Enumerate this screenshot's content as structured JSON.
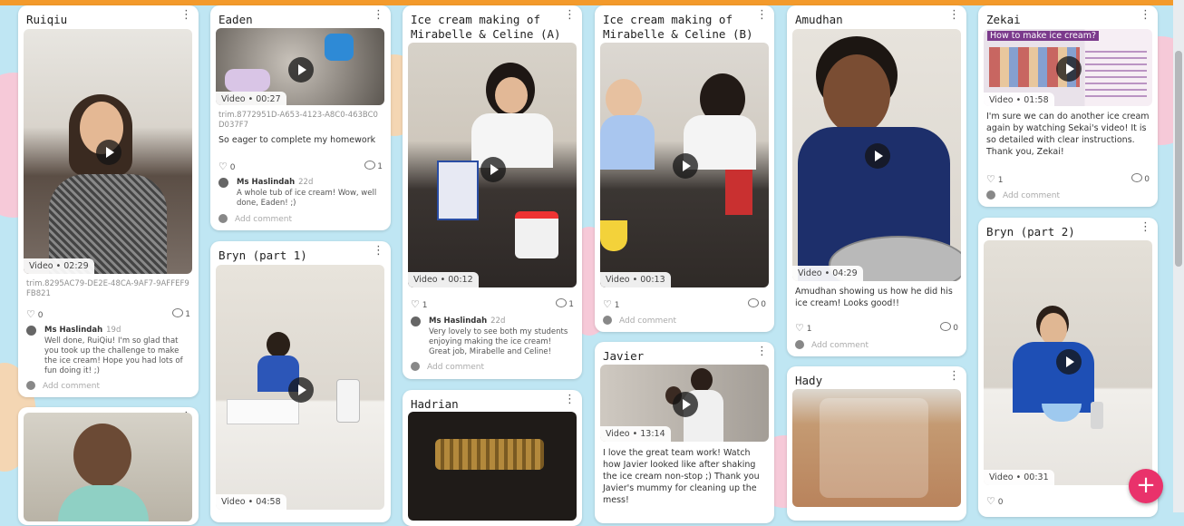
{
  "posts": {
    "ruiqiu": {
      "title": "Ruiqiu",
      "badge": "Video • 02:29",
      "filename": "trim.8295AC79-DE2E-48CA-9AF7-9AFFEF9FB821",
      "likes": "0",
      "comments": "1",
      "comment": {
        "author": "Ms Haslindah",
        "date": "19d",
        "text": "Well done, RuiQiu! I'm so glad that you took up the challenge to make the ice cream! Hope you had lots of fun doing it! ;)"
      },
      "add_comment": "Add comment"
    },
    "eaden": {
      "title": "Eaden",
      "badge": "Video • 00:27",
      "filename": "trim.8772951D-A653-4123-A8C0-463BC0D037F7",
      "text": "So eager to complete my homework",
      "likes": "0",
      "comments": "1",
      "comment": {
        "author": "Ms Haslindah",
        "date": "22d",
        "text": "A whole tub of ice cream! Wow, well done, Eaden! ;)"
      },
      "add_comment": "Add comment"
    },
    "bryn1": {
      "title": "Bryn (part 1)",
      "badge": "Video • 04:58"
    },
    "icecream_a": {
      "title": "Ice cream making of Mirabelle & Celine (A)",
      "badge": "Video • 00:12",
      "likes": "1",
      "comments": "1",
      "comment": {
        "author": "Ms Haslindah",
        "date": "22d",
        "text": "Very lovely to see both my students enjoying making the ice cream! Great job, Mirabelle and Celine!"
      },
      "add_comment": "Add comment"
    },
    "hadrian": {
      "title": "Hadrian"
    },
    "icecream_b": {
      "title": "Ice cream making of Mirabelle & Celine (B)",
      "badge": "Video • 00:13",
      "likes": "1",
      "comments": "0",
      "add_comment": "Add comment"
    },
    "javier": {
      "title": "Javier",
      "badge": "Video • 13:14",
      "text": "I love the great team work! Watch how Javier looked like after shaking the ice cream non-stop ;) Thank you Javier's mummy for cleaning up the mess!"
    },
    "amudhan": {
      "title": "Amudhan",
      "badge": "Video • 04:29",
      "text": "Amudhan showing us how he did his ice cream! Looks good!!",
      "likes": "1",
      "comments": "0",
      "add_comment": "Add comment"
    },
    "hady": {
      "title": "Hady"
    },
    "zekai": {
      "title": "Zekai",
      "badge": "Video • 01:58",
      "thumb_text": "How to make ice cream?",
      "text": "I'm sure we can do another ice cream again by watching Sekai's video! It is so detailed with clear instructions. Thank you, Zekai!",
      "likes": "1",
      "comments": "0",
      "add_comment": "Add comment"
    },
    "bryn2": {
      "title": "Bryn (part 2)",
      "badge": "Video • 00:31",
      "likes": "0"
    }
  },
  "fab_label": "+",
  "colors": {
    "background": "#bfe6f3",
    "accent": "#e9326b",
    "topbar": "#f39a2b"
  }
}
